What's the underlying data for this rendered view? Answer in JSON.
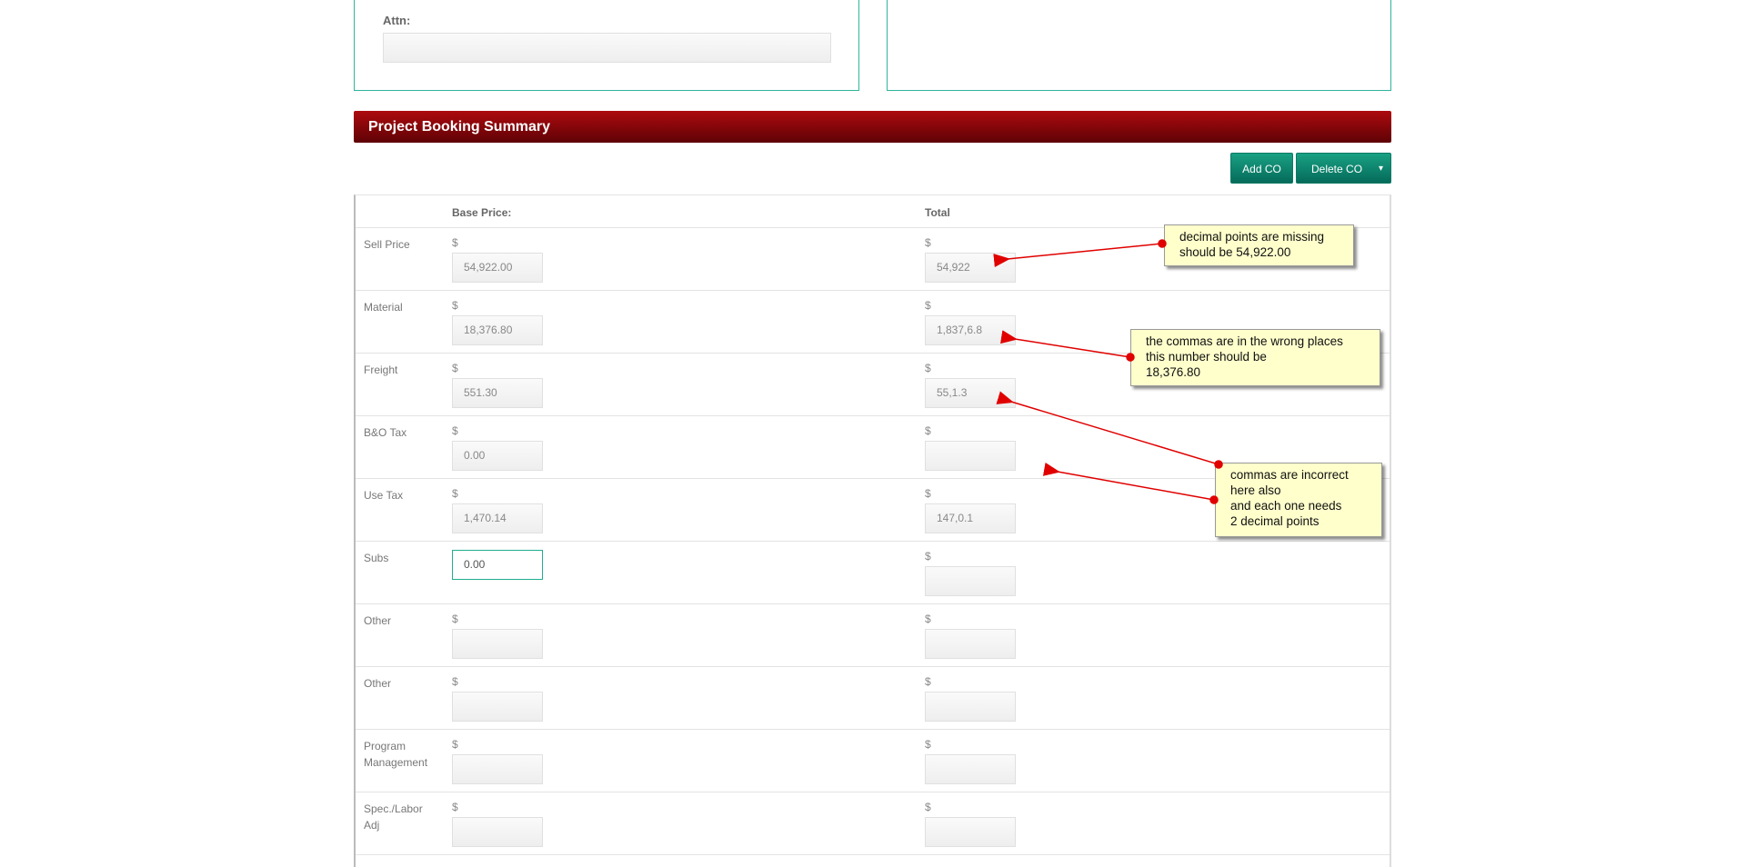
{
  "contact_box": {
    "attn_label": "Attn:",
    "attn_value": ""
  },
  "section": {
    "title": "Project Booking Summary"
  },
  "buttons": {
    "add_co": "Add CO",
    "delete_co": "Delete CO",
    "caret": "▾"
  },
  "table": {
    "headers": {
      "base": "Base Price:",
      "total": "Total"
    },
    "currency": "$",
    "rows": [
      {
        "label": "Sell Price",
        "base": "54,922.00",
        "total": "54,922"
      },
      {
        "label": "Material",
        "base": "18,376.80",
        "total": "1,837,6.8"
      },
      {
        "label": "Freight",
        "base": "551.30",
        "total": "55,1.3"
      },
      {
        "label": "B&O Tax",
        "base": "0.00",
        "total": ""
      },
      {
        "label": "Use Tax",
        "base": "1,470.14",
        "total": "147,0.1"
      },
      {
        "label": "Subs",
        "base": "0.00",
        "total": ""
      },
      {
        "label": "Other",
        "base": "",
        "total": ""
      },
      {
        "label": "Other",
        "base": "",
        "total": ""
      },
      {
        "label": "Program Management",
        "base": "",
        "total": ""
      },
      {
        "label": "Spec./Labor Adj",
        "base": "",
        "total": ""
      }
    ]
  },
  "annotations": [
    {
      "text": "decimal points are missing\nshould be 54,922.00"
    },
    {
      "text": "the commas are in the wrong places\nthis number should be\n18,376.80"
    },
    {
      "text": "commas are incorrect\nhere also\nand each one needs\n2 decimal points"
    }
  ],
  "colors": {
    "accent": "#1fae8e",
    "header": "#8b0509",
    "annotation_arrow": "#e00000"
  }
}
